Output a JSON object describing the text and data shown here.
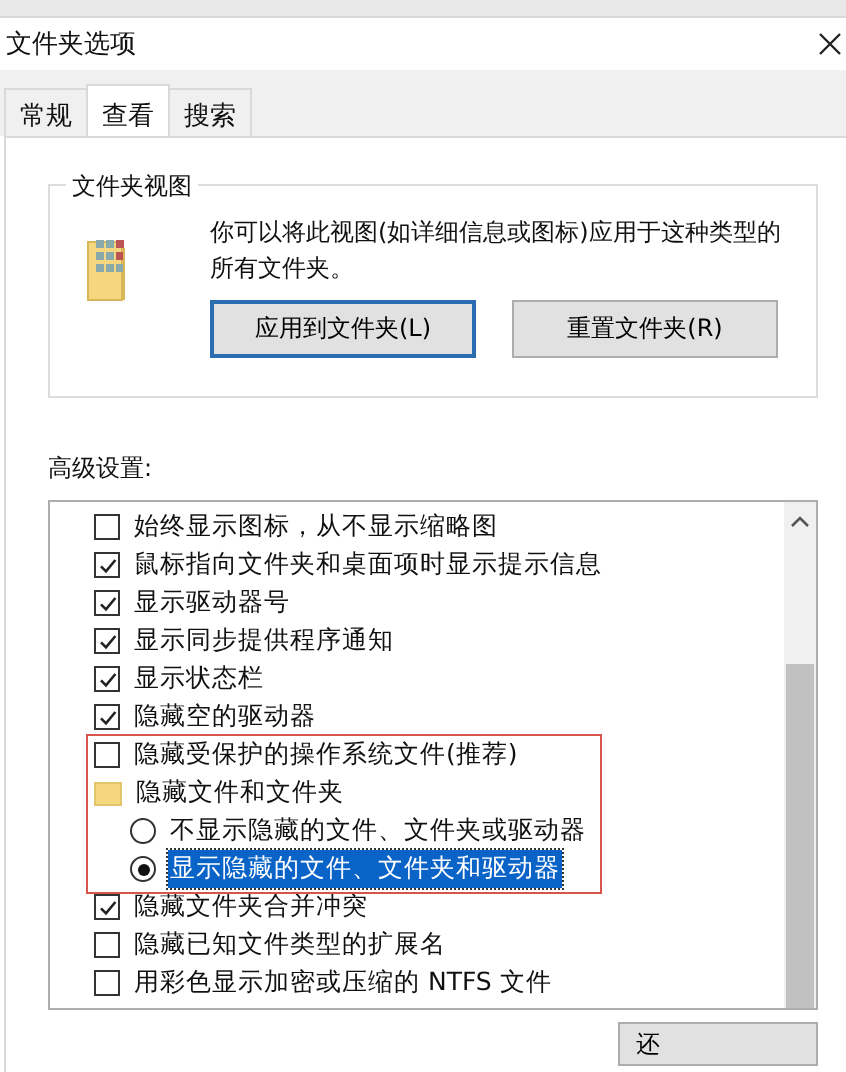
{
  "window": {
    "title": "文件夹选项"
  },
  "tabs": [
    {
      "label": "常规",
      "selected": false
    },
    {
      "label": "查看",
      "selected": true
    },
    {
      "label": "搜索",
      "selected": false
    }
  ],
  "folder_views": {
    "title": "文件夹视图",
    "description": "你可以将此视图(如详细信息或图标)应用于这种类型的所有文件夹。",
    "buttons": [
      {
        "label": "应用到文件夹(L)",
        "focused": true
      },
      {
        "label": "重置文件夹(R)",
        "focused": false
      }
    ]
  },
  "advanced": {
    "label": "高级设置:",
    "items": [
      {
        "kind": "checkbox",
        "label": "始终显示图标，从不显示缩略图",
        "checked": false
      },
      {
        "kind": "checkbox",
        "label": "鼠标指向文件夹和桌面项时显示提示信息",
        "checked": true
      },
      {
        "kind": "checkbox",
        "label": "显示驱动器号",
        "checked": true
      },
      {
        "kind": "checkbox",
        "label": "显示同步提供程序通知",
        "checked": true
      },
      {
        "kind": "checkbox",
        "label": "显示状态栏",
        "checked": true
      },
      {
        "kind": "checkbox",
        "label": "隐藏空的驱动器",
        "checked": true
      },
      {
        "kind": "checkbox",
        "label": "隐藏受保护的操作系统文件(推荐)",
        "checked": false
      },
      {
        "kind": "folder",
        "label": "隐藏文件和文件夹",
        "children": [
          {
            "kind": "radio",
            "label": "不显示隐藏的文件、文件夹或驱动器",
            "selected": false
          },
          {
            "kind": "radio",
            "label": "显示隐藏的文件、文件夹和驱动器",
            "selected": true
          }
        ]
      },
      {
        "kind": "checkbox",
        "label": "隐藏文件夹合并冲突",
        "checked": true
      },
      {
        "kind": "checkbox",
        "label": "隐藏已知文件类型的扩展名",
        "checked": false
      },
      {
        "kind": "checkbox",
        "label": "用彩色显示加密或压缩的 NTFS 文件",
        "checked": false
      }
    ]
  },
  "footer_button": {
    "label": "还"
  }
}
